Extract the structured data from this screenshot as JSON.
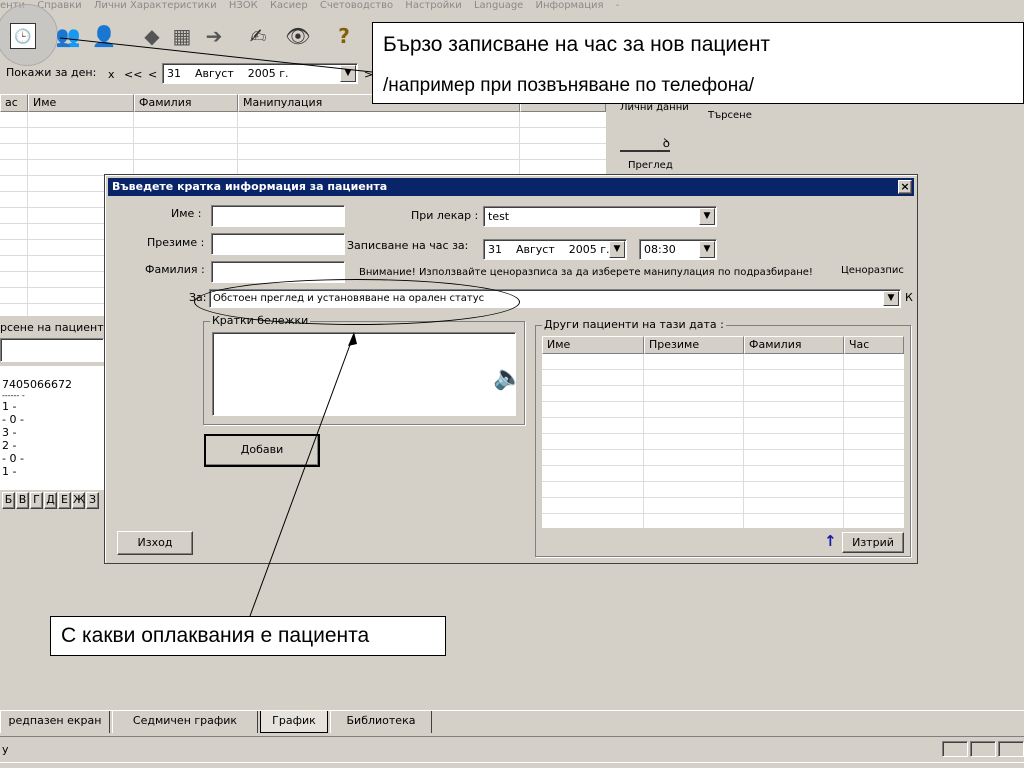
{
  "menu": [
    "енти",
    "Справки",
    "Лични Характеристики",
    "НЗОК",
    "Касиер",
    "Счетоводство",
    "Настройки",
    "Language",
    "Информация",
    "-"
  ],
  "toolbar": {
    "show_for_day_label": "Покажи за ден:",
    "nav": [
      "x",
      "<<",
      "<"
    ],
    "date": {
      "day": "31",
      "month": "Август",
      "year": "2005 г."
    },
    "next_partial": ">"
  },
  "schedule_grid": {
    "columns": [
      "ас",
      "Име",
      "Фамилия",
      "Манипулация"
    ]
  },
  "right_panel": {
    "personal_data": "Лични данни",
    "search": "Търсене",
    "exam": "Преглед"
  },
  "left_panel": {
    "search_label": "рсене на пациент:",
    "egn": "7405066672",
    "dashes": "------  -",
    "stats": [
      "1  -",
      "- 0  -",
      "3  -",
      "2  -",
      "- 0  -",
      "1  -"
    ],
    "alphabet": [
      "Б",
      "В",
      "Г",
      "Д",
      "Е",
      "Ж",
      "З"
    ]
  },
  "callouts": {
    "top_line1": "Бързо записване на час за нов пациент",
    "top_line2": "/например при позвъняване по телефона/",
    "bottom": "С какви оплаквания е пациента"
  },
  "dialog": {
    "title": "Въведете кратка информация за пациента",
    "close": "×",
    "first_name_label": "Име :",
    "middle_name_label": "Презиме :",
    "last_name_label": "Фамилия :",
    "first_name_value": "",
    "middle_name_value": "",
    "last_name_value": "",
    "doctor_label": "При лекар :",
    "doctor_value": "test",
    "appointment_label": "Записване на час за:",
    "appt_date": {
      "day": "31",
      "month": "Август",
      "year": "2005 г."
    },
    "appt_time": "08:30",
    "warning": "Внимание! Използвайте ценоразписа за да изберете манипулация по подразбиране!",
    "price_list": "Ценоразпис",
    "for_label": "За:",
    "for_value": "Обстоен преглед и установяване на орален статус",
    "for_suffix": "К",
    "notes_label": "Кратки бележки",
    "notes_value": "",
    "add_button": "Добави",
    "exit_button": "Изход",
    "others_label": "Други пациенти на тази дата :",
    "others_columns": [
      "Име",
      "Презиме",
      "Фамилия",
      "Час"
    ],
    "delete_button": "Изтрий"
  },
  "tabs": [
    "редпазен екран",
    "Седмичен график",
    "График",
    "Библиотека"
  ],
  "status_text": "y"
}
